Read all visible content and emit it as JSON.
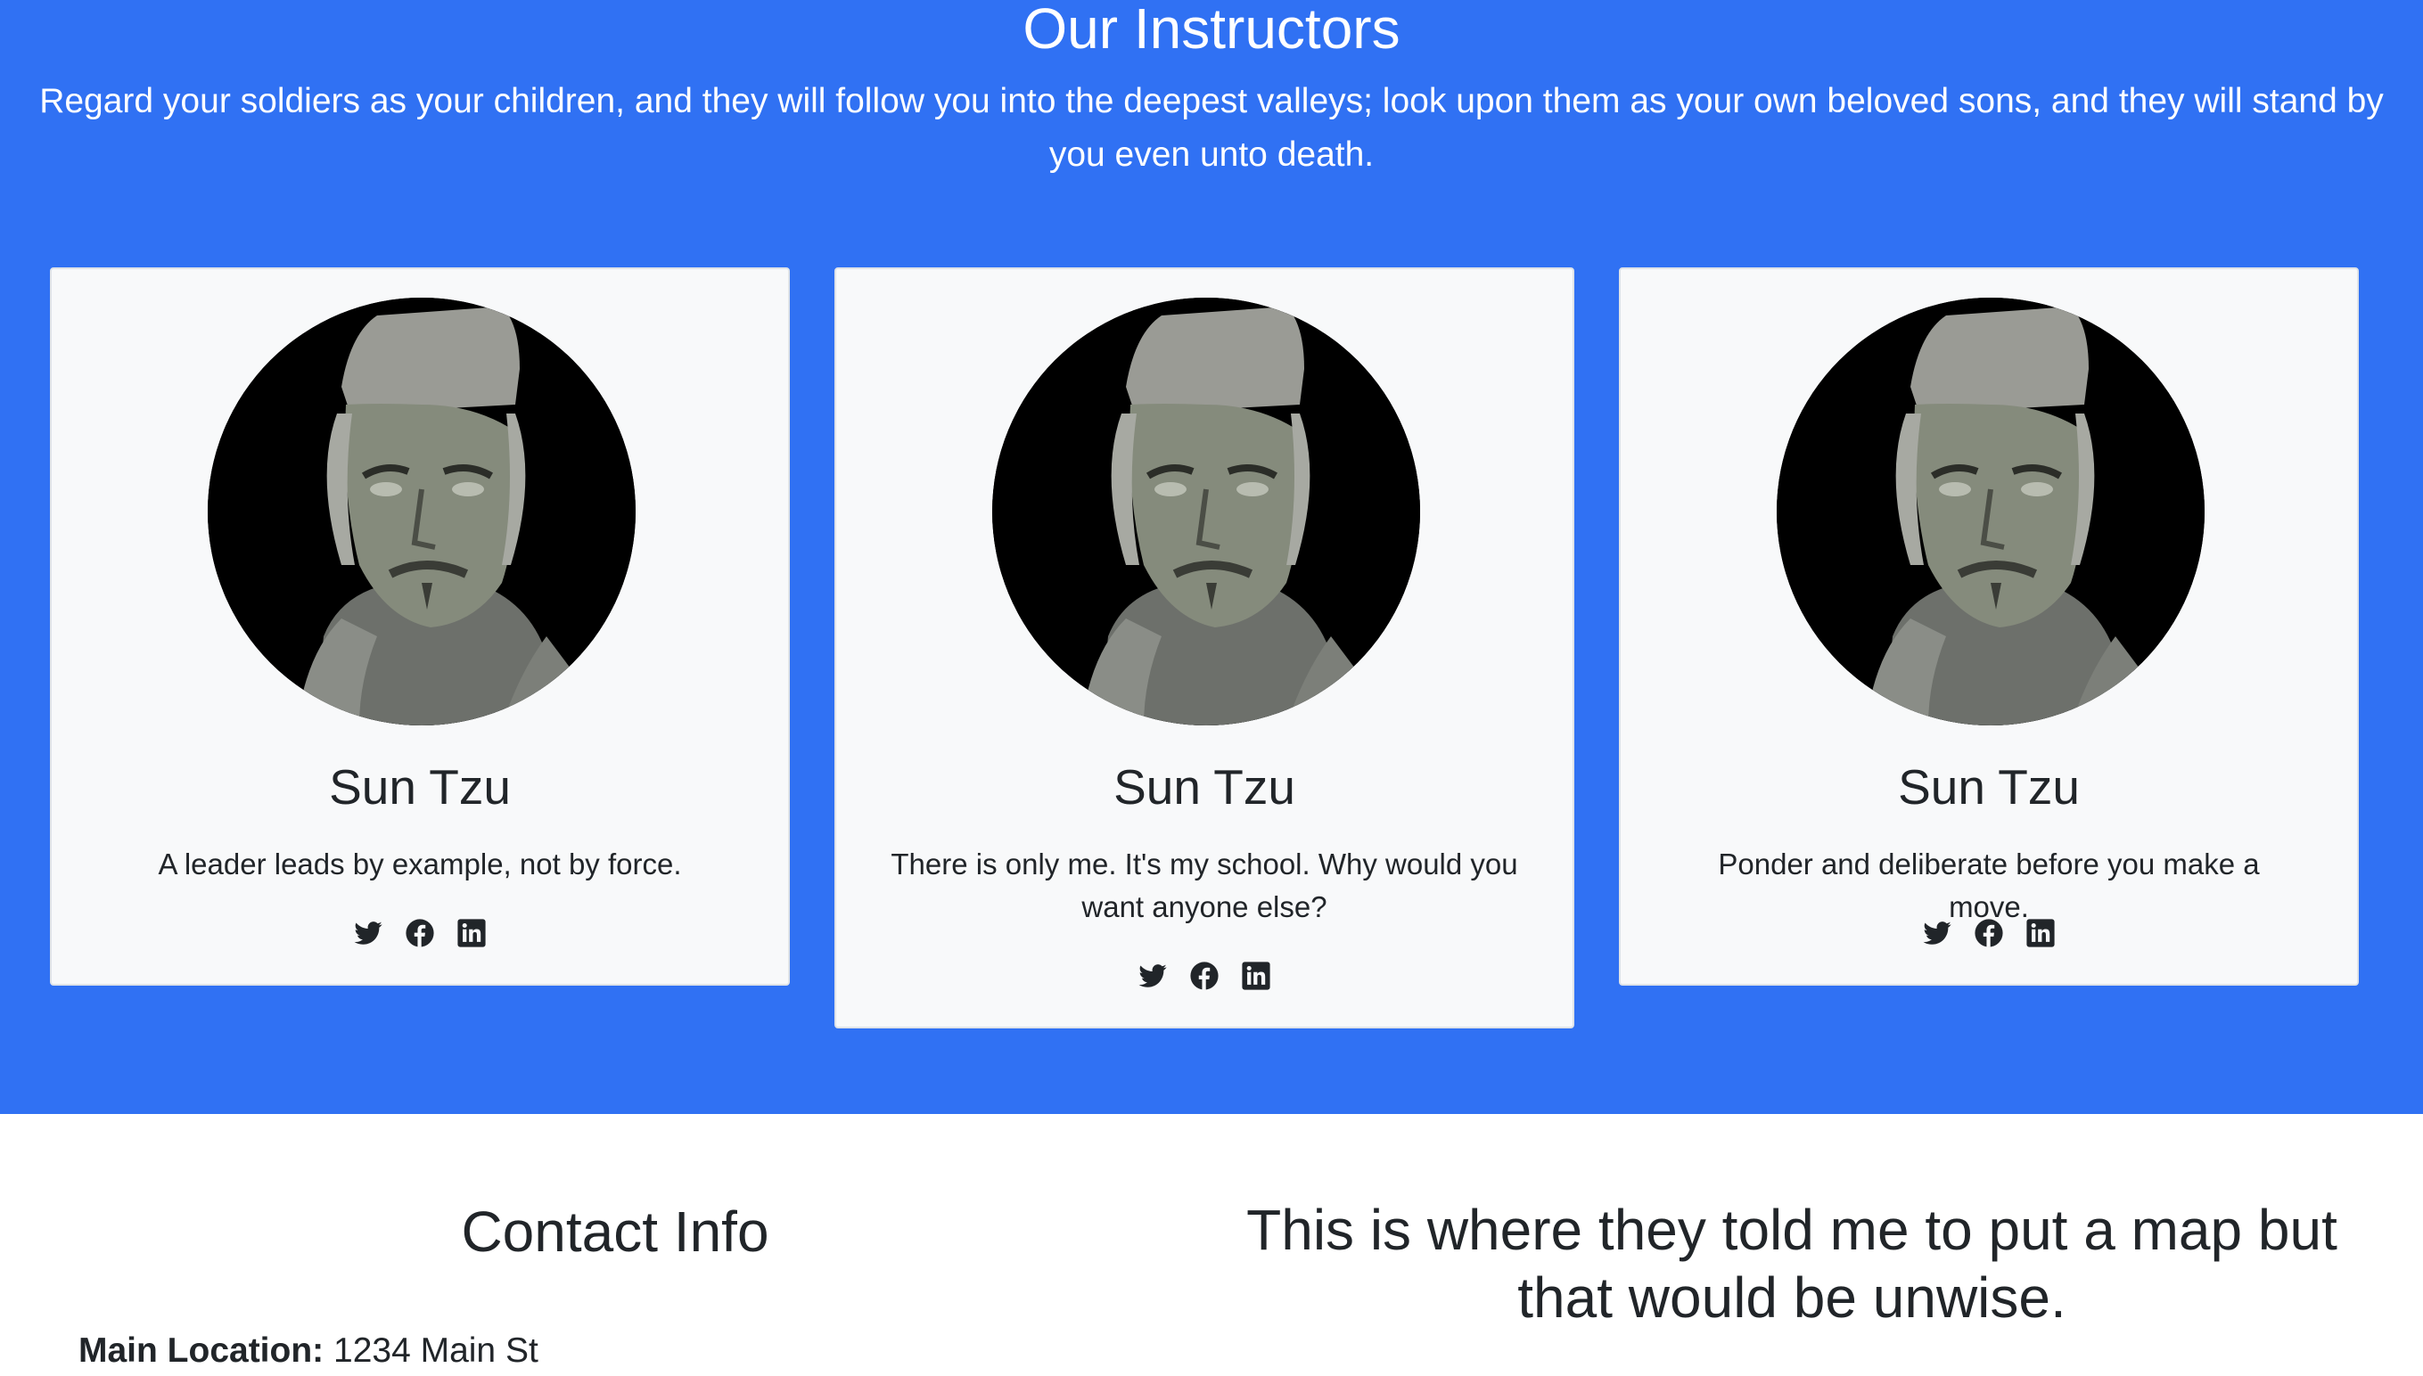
{
  "instructors": {
    "title": "Our Instructors",
    "subtitle": "Regard your soldiers as your children, and they will follow you into the deepest valleys; look upon them as your own beloved sons, and they will stand by you even unto death.",
    "cards": [
      {
        "name": "Sun Tzu",
        "quote": "A leader leads by example, not by force."
      },
      {
        "name": "Sun Tzu",
        "quote": "There is only me. It's my school. Why would you want anyone else?"
      },
      {
        "name": "Sun Tzu",
        "quote": "Ponder and deliberate before you make a move."
      }
    ],
    "social_icons": [
      "twitter-icon",
      "facebook-icon",
      "linkedin-icon"
    ]
  },
  "contact": {
    "title": "Contact Info",
    "location_label": "Main Location:",
    "location_value": "1234 Main St"
  },
  "map_note": "This is where they told me to put a map but that would be unwise.",
  "colors": {
    "section_bg": "#3071f3",
    "card_bg": "#f8f9fa",
    "text_dark": "#212529",
    "text_light": "#ffffff"
  }
}
